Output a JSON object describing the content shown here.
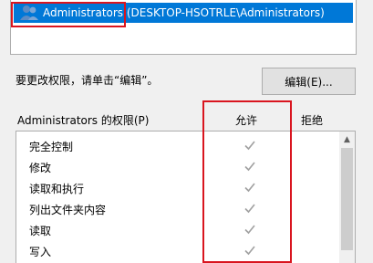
{
  "principal": {
    "name": "Administrators (DESKTOP-HSOTRLE\\Administrators)"
  },
  "hint": "要更改权限，请单击“编辑”。",
  "edit_button": "编辑(E)...",
  "permissions": {
    "header": "Administrators 的权限(P)",
    "allow_header": "允许",
    "deny_header": "拒绝",
    "rows": [
      {
        "label": "完全控制",
        "allow": true,
        "deny": false
      },
      {
        "label": "修改",
        "allow": true,
        "deny": false
      },
      {
        "label": "读取和执行",
        "allow": true,
        "deny": false
      },
      {
        "label": "列出文件夹内容",
        "allow": true,
        "deny": false
      },
      {
        "label": "读取",
        "allow": true,
        "deny": false
      },
      {
        "label": "写入",
        "allow": true,
        "deny": false
      }
    ]
  },
  "colors": {
    "selection": "#0078d7",
    "annotation_red": "#d9151f",
    "check_gray": "#a0a0a0"
  }
}
